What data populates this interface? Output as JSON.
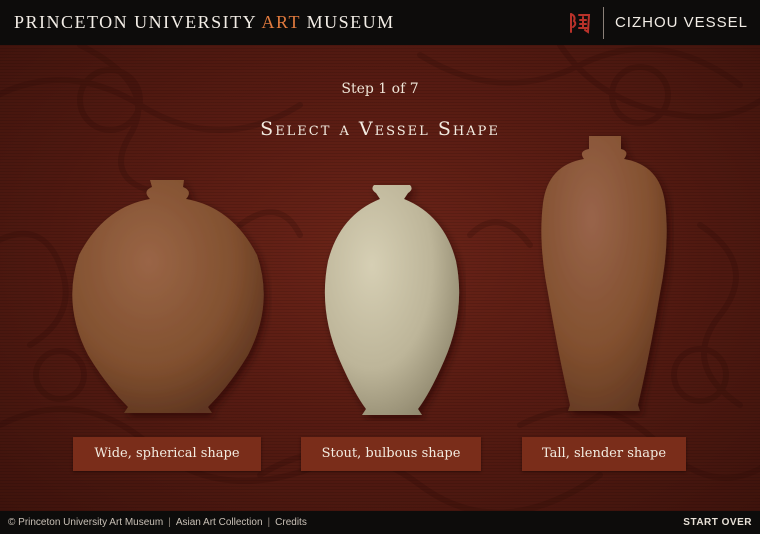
{
  "header": {
    "brand_prefix": "PRINCETON UNIVERSITY",
    "brand_accent": "ART",
    "brand_suffix": "MUSEUM",
    "seal_icon": "tao-character-icon",
    "vessel_title": "CIZHOU VESSEL"
  },
  "main": {
    "step": "Step 1 of 7",
    "heading": "Select a Vessel Shape",
    "choices": [
      {
        "label": "Wide, spherical shape",
        "vessel_color": "#8c5a3e"
      },
      {
        "label": "Stout, bulbous shape",
        "vessel_color": "#c9c2a6"
      },
      {
        "label": "Tall, slender shape",
        "vessel_color": "#8c5a3e"
      }
    ]
  },
  "footer": {
    "copyright": "© Princeton University Art Museum",
    "asian_art": "Asian Art Collection",
    "credits": "Credits",
    "start_over": "START OVER"
  },
  "colors": {
    "accent": "#e07a3e",
    "background": "#5a1c13",
    "button": "#7a2d1a"
  }
}
